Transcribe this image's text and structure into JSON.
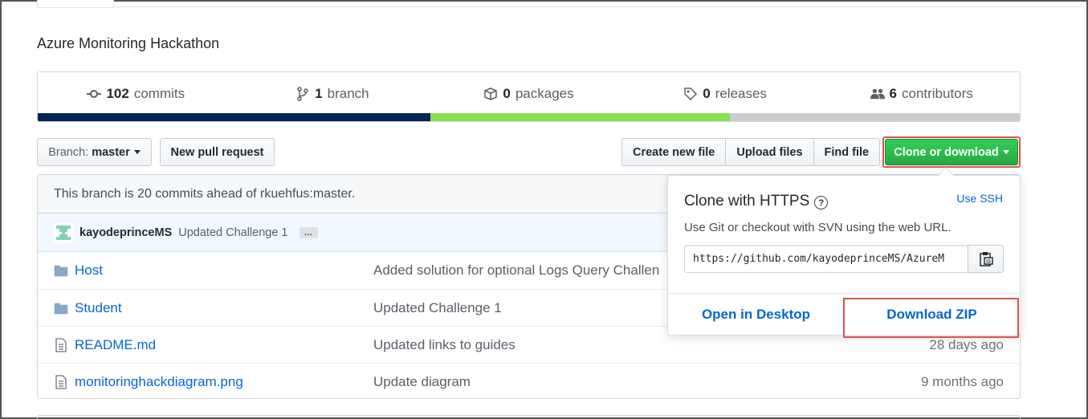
{
  "repo": {
    "description": "Azure Monitoring Hackathon"
  },
  "stats": [
    {
      "icon": "commits-icon",
      "count": "102",
      "label": "commits"
    },
    {
      "icon": "branch-icon",
      "count": "1",
      "label": "branch"
    },
    {
      "icon": "package-icon",
      "count": "0",
      "label": "packages"
    },
    {
      "icon": "tag-icon",
      "count": "0",
      "label": "releases"
    },
    {
      "icon": "people-icon",
      "count": "6",
      "label": "contributors"
    }
  ],
  "language_bar": {
    "segments": [
      {
        "color": "#012456",
        "percent": 40
      },
      {
        "color": "#89e051",
        "percent": 30.5
      },
      {
        "color": "#cccccc",
        "percent": 29.5
      }
    ]
  },
  "toolbar": {
    "branch_prefix": "Branch:",
    "branch_name": "master",
    "new_pull_request": "New pull request",
    "create_new_file": "Create new file",
    "upload_files": "Upload files",
    "find_file": "Find file",
    "clone_or_download": "Clone or download",
    "clone_color": "#28a745"
  },
  "branch_status": "This branch is 20 commits ahead of rkuehfus:master.",
  "latest_commit": {
    "author": "kayodeprinceMS",
    "message": "Updated Challenge 1",
    "ellipsis": "…"
  },
  "files": [
    {
      "type": "folder",
      "icon": "folder-icon",
      "name": "Host",
      "message": "Added solution for optional Logs Query Challen",
      "age": ""
    },
    {
      "type": "folder",
      "icon": "folder-icon",
      "name": "Student",
      "message": "Updated Challenge 1",
      "age": ""
    },
    {
      "type": "file",
      "icon": "file-icon",
      "name": "README.md",
      "message": "Updated links to guides",
      "age": "28 days ago"
    },
    {
      "type": "file",
      "icon": "file-icon",
      "name": "monitoringhackdiagram.png",
      "message": "Update diagram",
      "age": "9 months ago"
    }
  ],
  "clone_popover": {
    "title": "Clone with HTTPS",
    "use_ssh": "Use SSH",
    "description": "Use Git or checkout with SVN using the web URL.",
    "url": "https://github.com/kayodeprinceMS/AzureM",
    "open_desktop": "Open in Desktop",
    "download_zip": "Download ZIP"
  },
  "highlight_color": "#d9534f"
}
